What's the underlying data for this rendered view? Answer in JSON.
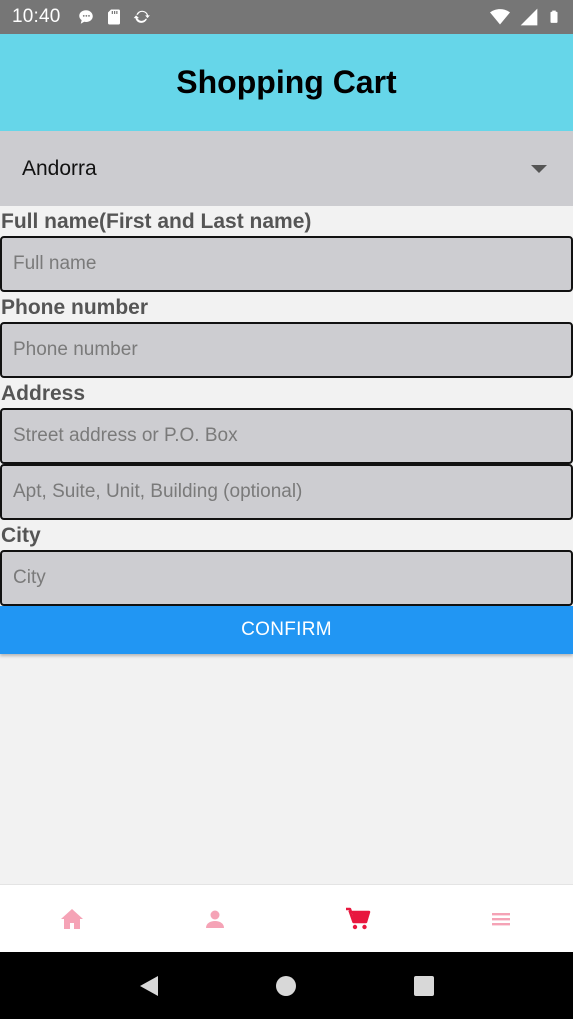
{
  "status_bar": {
    "time": "10:40",
    "left_icons": [
      "chat-notification-icon",
      "sd-card-icon",
      "sync-icon"
    ],
    "right_icons": [
      "wifi-icon",
      "signal-icon",
      "battery-icon"
    ]
  },
  "header": {
    "title": "Shopping Cart",
    "background": "#66d6e9"
  },
  "country": {
    "selected": "Andorra"
  },
  "form": {
    "full_name": {
      "label": "Full name(First and Last name)",
      "placeholder": "Full name",
      "value": ""
    },
    "phone": {
      "label": "Phone number",
      "placeholder": "Phone number",
      "value": ""
    },
    "address": {
      "label": "Address",
      "line1_placeholder": "Street address or P.O. Box",
      "line2_placeholder": "Apt, Suite, Unit, Building (optional)"
    },
    "city": {
      "label": "City",
      "placeholder": "City",
      "value": ""
    }
  },
  "confirm": {
    "label": "CONFIRM",
    "color": "#2196f3"
  },
  "bottom_nav": {
    "items": [
      {
        "name": "home",
        "icon": "home-icon",
        "active": false
      },
      {
        "name": "profile",
        "icon": "person-icon",
        "active": false
      },
      {
        "name": "cart",
        "icon": "cart-icon",
        "active": true
      },
      {
        "name": "menu",
        "icon": "menu-icon",
        "active": false
      }
    ],
    "active_color": "#e8173e",
    "inactive_color": "#f5a3b6"
  },
  "system_nav": [
    "back-icon",
    "home-circle-icon",
    "recents-icon"
  ]
}
